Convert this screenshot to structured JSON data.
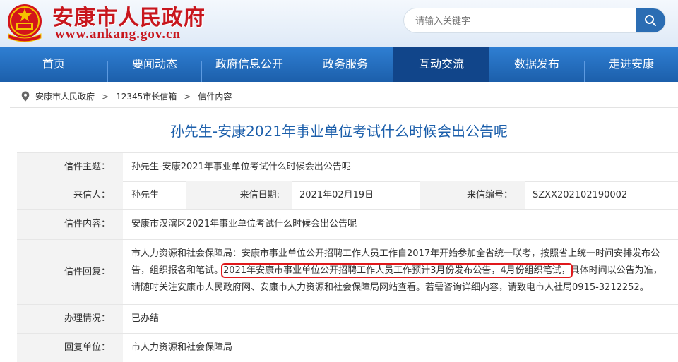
{
  "header": {
    "site_title": "安康市人民政府",
    "site_url": "www.ankang.gov.cn",
    "emblem_icon": "national-emblem-icon",
    "brand_red": "#c8161d"
  },
  "search": {
    "placeholder": "请输入关键字",
    "icon": "search-icon"
  },
  "nav": {
    "items": [
      "首页",
      "要闻动态",
      "政府信息公开",
      "政务服务",
      "互动交流",
      "数据发布",
      "走进安康"
    ],
    "active": "互动交流",
    "color": "#1c5fab"
  },
  "breadcrumb": {
    "icon": "location-pin-icon",
    "items": [
      "安康市人民政府",
      "12345市长信箱",
      "信件内容"
    ],
    "separator": ">"
  },
  "letter": {
    "title": "孙先生-安康2021年事业单位考试什么时候会出公告呢",
    "labels": {
      "subject": "信件主题：",
      "sender": "来信人：",
      "date": "来信日期:",
      "number": "来信编号：",
      "content": "信件内容：",
      "reply": "信件回复：",
      "status": "办理情况：",
      "unit": "回复单位："
    },
    "subject": "孙先生-安康2021年事业单位考试什么时候会出公告呢",
    "sender": "孙先生",
    "date": "2021年02月19日",
    "number": "SZXX202102190002",
    "content": "安康市汉滨区2021年事业单位考试什么时候会出公告呢",
    "reply_part1": "市人力资源和社会保障局：安康市事业单位公开招聘工作人员工作自2017年开始参加全省统一联考，按照省上统一时间安排发布公告，组织报名和笔试。",
    "reply_highlight": "2021年安康市事业单位公开招聘工作人员工作预计3月份发布公告，4月份组织笔试，",
    "reply_part2": "具体时间以公告为准，请随时关注安康市人民政府网、安康市人力资源和社会保障局网站查看。若需咨询详细内容，请致电市人社局0915-3212252。",
    "status": "已办结",
    "unit": "市人力资源和社会保障局",
    "highlight_color": "#e0181b"
  }
}
